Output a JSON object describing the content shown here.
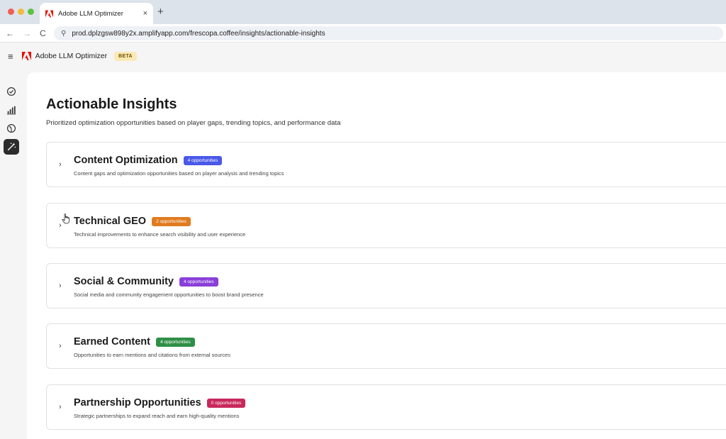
{
  "browser": {
    "tab_title": "Adobe LLM Optimizer",
    "tab_close": "×",
    "new_tab": "+",
    "nav_back": "←",
    "nav_forward": "→",
    "nav_reload": "C",
    "site_info": "⚲",
    "url": "prod.dplzgsw898y2x.amplifyapp.com/frescopa.coffee/insights/actionable-insights"
  },
  "app": {
    "menu_glyph": "≡",
    "name": "Adobe LLM Optimizer",
    "beta_label": "BETA",
    "brand_color": "#eb1000"
  },
  "rail": {
    "items": [
      {
        "icon": "check-circle-icon",
        "active": false
      },
      {
        "icon": "bar-chart-icon",
        "active": false
      },
      {
        "icon": "gauge-icon",
        "active": false
      },
      {
        "icon": "magic-wand-icon",
        "active": true
      }
    ]
  },
  "page": {
    "title": "Actionable Insights",
    "subtitle": "Prioritized optimization opportunities based on player gaps, trending topics, and performance data"
  },
  "sections": [
    {
      "title": "Content Optimization",
      "badge": "4 opportunities",
      "badge_color": "#4a58e8",
      "description": "Content gaps and optimization opportunities based on player analysis and trending topics"
    },
    {
      "title": "Technical GEO",
      "badge": "2 opportunities",
      "badge_color": "#e07b1f",
      "description": "Technical improvements to enhance search visibility and user experience"
    },
    {
      "title": "Social & Community",
      "badge": "4 opportunities",
      "badge_color": "#8a3fd9",
      "description": "Social media and community engagement opportunities to boost brand presence"
    },
    {
      "title": "Earned Content",
      "badge": "4 opportunities",
      "badge_color": "#2f8f47",
      "description": "Opportunities to earn mentions and citations from external sources"
    },
    {
      "title": "Partnership Opportunities",
      "badge": "0 opportunities",
      "badge_color": "#c8285c",
      "description": "Strategic partnerships to expand reach and earn high-quality mentions"
    }
  ],
  "chevron": "›"
}
